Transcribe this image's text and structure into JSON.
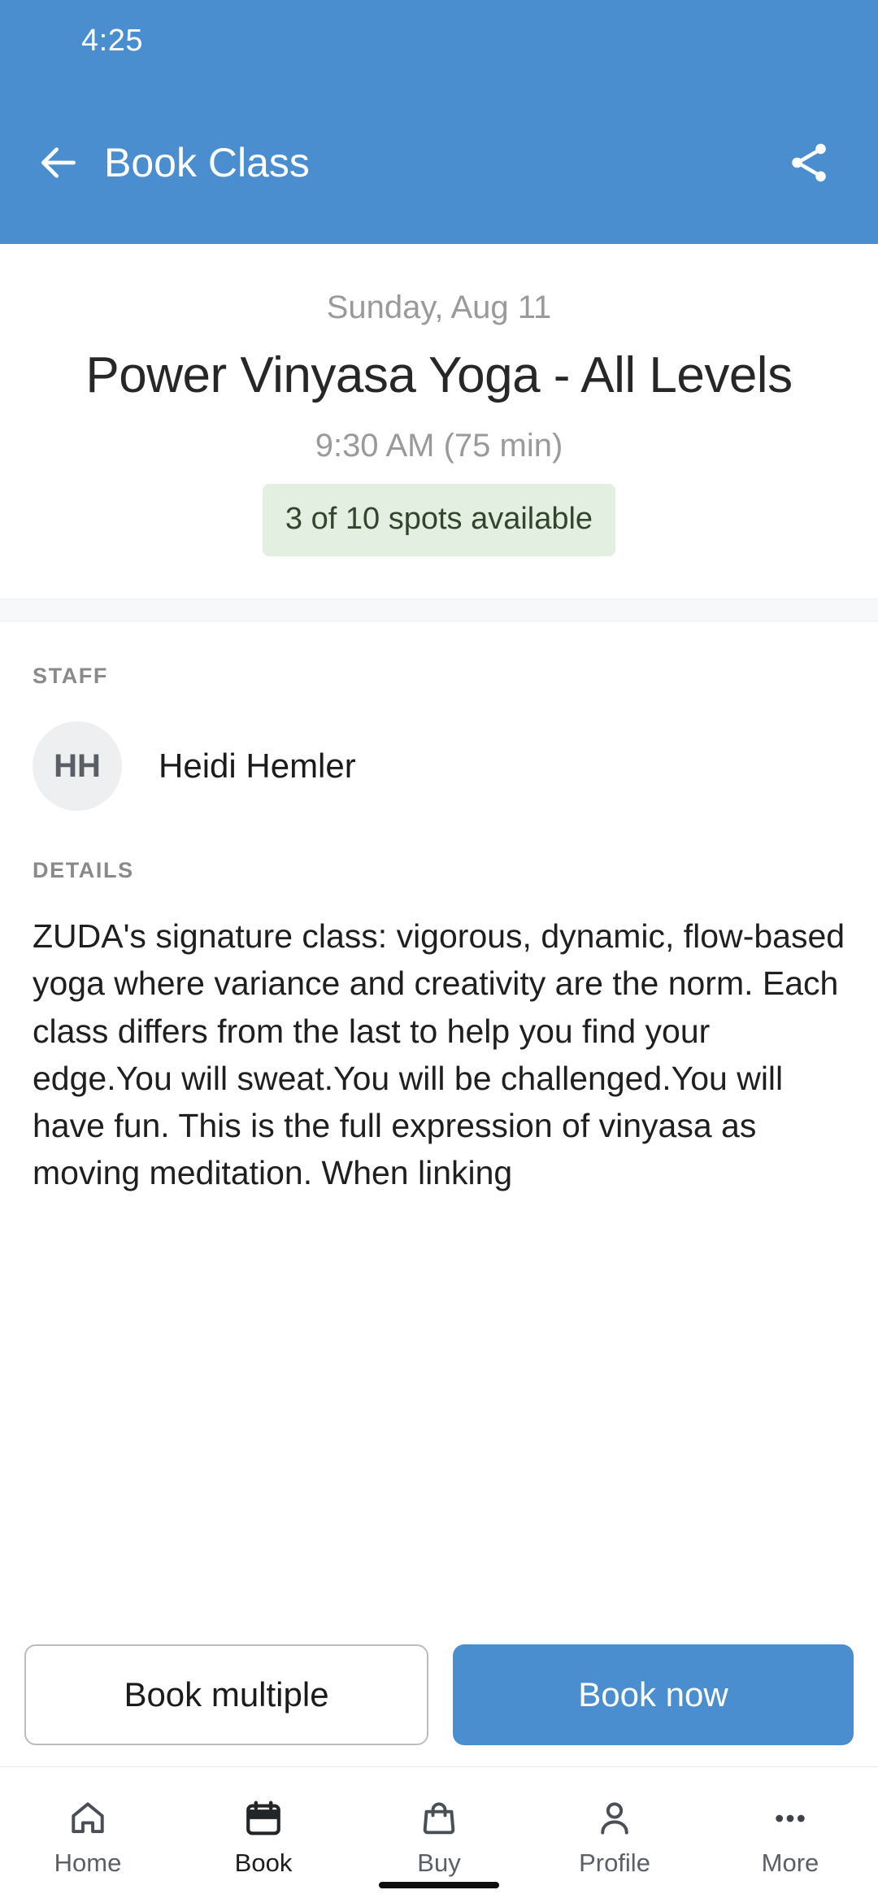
{
  "status_bar": {
    "time": "4:25"
  },
  "app_bar": {
    "title": "Book Class",
    "back_icon": "arrow-left-icon",
    "share_icon": "share-icon",
    "background_color": "#4A8ED0"
  },
  "hero": {
    "date": "Sunday, Aug 11",
    "class_title": "Power Vinyasa Yoga - All Levels",
    "time": "9:30 AM (75 min)",
    "availability": "3 of 10 spots available",
    "availability_bg_color": "#E3F0E1",
    "availability_text_color": "#32452E"
  },
  "staff": {
    "section_label": "STAFF",
    "initials": "HH",
    "name": "Heidi Hemler"
  },
  "details": {
    "section_label": "DETAILS",
    "text": "ZUDA's signature class: vigorous, dynamic, flow-based yoga where variance and creativity are the norm. Each class differs from the last to help you find your edge.You will sweat.You will be challenged.You will have fun.   This is the full expression of vinyasa as moving meditation. When linking"
  },
  "actions": {
    "secondary_label": "Book multiple",
    "primary_label": "Book now",
    "primary_color": "#4A8ED0"
  },
  "bottom_nav": {
    "items": [
      {
        "label": "Home",
        "icon": "home-icon",
        "active": false
      },
      {
        "label": "Book",
        "icon": "calendar-icon",
        "active": true
      },
      {
        "label": "Buy",
        "icon": "shopping-bag-icon",
        "active": false
      },
      {
        "label": "Profile",
        "icon": "person-icon",
        "active": false
      },
      {
        "label": "More",
        "icon": "ellipsis-icon",
        "active": false
      }
    ]
  }
}
